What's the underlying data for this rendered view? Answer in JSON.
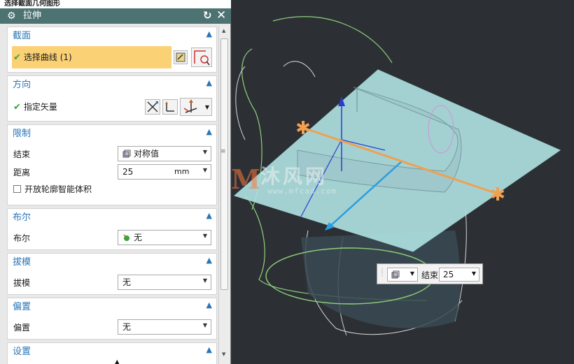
{
  "cue_line": "选择截面几何图形",
  "dialog": {
    "title": "拉伸"
  },
  "sections": {
    "section": {
      "title": "截面",
      "select_curve": "选择曲线 (1)"
    },
    "direction": {
      "title": "方向",
      "specify_vector": "指定矢量"
    },
    "limits": {
      "title": "限制",
      "end_label": "结束",
      "end_value": "对称值",
      "distance_label": "距离",
      "distance_value": "25",
      "distance_unit": "mm",
      "open_profile_label": "开放轮廓智能体积"
    },
    "boolean": {
      "title": "布尔",
      "label": "布尔",
      "value": "无"
    },
    "draft": {
      "title": "拔模",
      "label": "拔模",
      "value": "无"
    },
    "offset": {
      "title": "偏置",
      "label": "偏置",
      "value": "无"
    },
    "settings": {
      "title": "设置"
    }
  },
  "onscreen_input": {
    "label": "结束",
    "value": "25"
  },
  "watermark": {
    "text": "沐风网",
    "url": "www.mfcad.com"
  },
  "colors": {
    "title_bar": "#4d7272",
    "section_title": "#2a75b6",
    "selection_highlight": "#fbd175",
    "plane": "#aee0e0",
    "handle": "#f0a050"
  }
}
